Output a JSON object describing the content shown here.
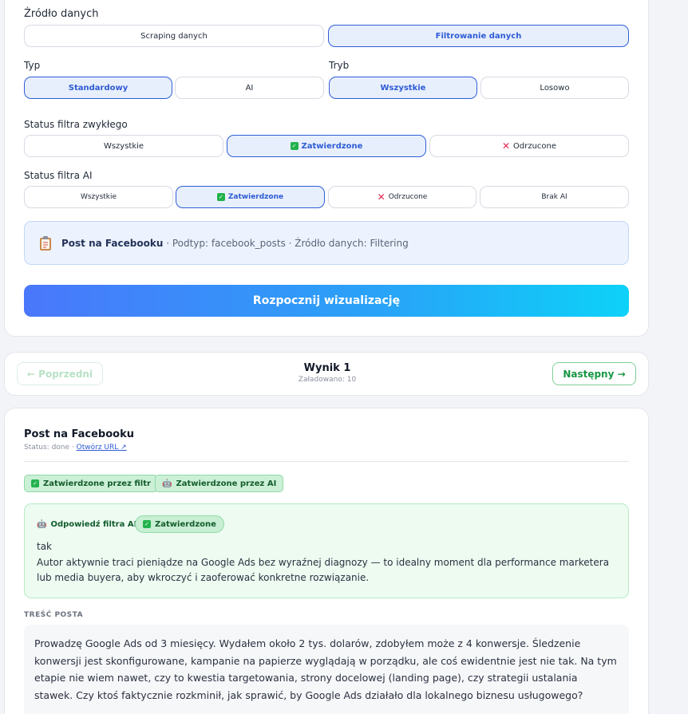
{
  "source": {
    "label": "Źródło danych",
    "options": [
      "Scraping danych",
      "Filtrowanie danych"
    ]
  },
  "type": {
    "label": "Typ",
    "options": [
      "Standardowy",
      "AI"
    ]
  },
  "mode": {
    "label": "Tryb",
    "options": [
      "Wszystkie",
      "Losowo"
    ]
  },
  "regular_filter": {
    "label": "Status filtra zwykłego",
    "options": [
      "Wszystkie",
      "Zatwierdzone",
      "Odrzucone"
    ]
  },
  "ai_filter": {
    "label": "Status filtra AI",
    "options": [
      "Wszystkie",
      "Zatwierdzone",
      "Odrzucone",
      "Brak AI"
    ]
  },
  "info": {
    "title": "Post na Facebooku",
    "details": "· Podtyp: facebook_posts · Źródło danych: Filtering"
  },
  "start_button": "Rozpocznij wizualizację",
  "nav": {
    "prev": "← Poprzedni",
    "next": "Następny →",
    "title": "Wynik 1",
    "loaded": "Załadowano: 10"
  },
  "result": {
    "title": "Post na Facebooku",
    "status": "Status: done ·",
    "url_link": "Otwórz URL ↗",
    "badge_filter": "Zatwierdzone przez filtr",
    "badge_ai": "Zatwierdzone przez AI",
    "ai_response_label": "Odpowiedź filtra AI",
    "ai_response_pill": "Zatwierdzone",
    "ai_answer": "tak",
    "ai_reason": "Autor aktywnie traci pieniądze na Google Ads bez wyraźnej diagnozy — to idealny moment dla performance marketera lub media buyera, aby wkroczyć i zaoferować konkretne rozwiązanie.",
    "content_label": "TREŚĆ POSTA",
    "content": "Prowadzę Google Ads od 3 miesięcy. Wydałem około 2 tys. dolarów, zdobyłem może z 4 konwersje. Śledzenie konwersji jest skonfigurowane, kampanie na papierze wyglądają w porządku, ale coś ewidentnie jest nie tak. Na tym etapie nie wiem nawet, czy to kwestia targetowania, strony docelowej (landing page), czy strategii ustalania stawek. Czy ktoś faktycznie rozkminił, jak sprawić, by Google Ads działało dla lokalnego biznesu usługowego?"
  },
  "colors": {
    "accent_blue": "#2f5ed8",
    "success_green": "#22b24c",
    "danger_red": "#e0284f",
    "gradient_start": "#4a77fb",
    "gradient_end": "#0dd2f8"
  }
}
